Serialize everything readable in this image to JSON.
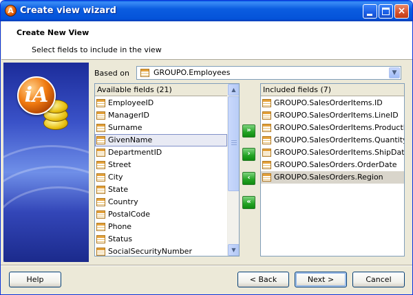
{
  "window": {
    "title": "Create view wizard",
    "app_icon_letter": "A"
  },
  "header": {
    "title": "Create New View",
    "subtitle": "Select fields to include in the view"
  },
  "sidebar_image": {
    "logo_text": "iA"
  },
  "based_on": {
    "label": "Based on",
    "value": "GROUPO.Employees",
    "icon": "table-icon"
  },
  "available": {
    "header": "Available fields (21)",
    "items": [
      {
        "label": "EmployeeID"
      },
      {
        "label": "ManagerID"
      },
      {
        "label": "Surname"
      },
      {
        "label": "GivenName",
        "selected": true
      },
      {
        "label": "DepartmentID"
      },
      {
        "label": "Street"
      },
      {
        "label": "City"
      },
      {
        "label": "State"
      },
      {
        "label": "Country"
      },
      {
        "label": "PostalCode"
      },
      {
        "label": "Phone"
      },
      {
        "label": "Status"
      },
      {
        "label": "SocialSecurityNumber"
      }
    ]
  },
  "included": {
    "header": "Included fields (7)",
    "items": [
      {
        "label": "GROUPO.SalesOrderItems.ID"
      },
      {
        "label": "GROUPO.SalesOrderItems.LineID"
      },
      {
        "label": "GROUPO.SalesOrderItems.ProductID"
      },
      {
        "label": "GROUPO.SalesOrderItems.Quantity"
      },
      {
        "label": "GROUPO.SalesOrderItems.ShipDate"
      },
      {
        "label": "GROUPO.SalesOrders.OrderDate"
      },
      {
        "label": "GROUPO.SalesOrders.Region",
        "selected": true
      }
    ]
  },
  "move_buttons": {
    "add_all": "»",
    "add": "›",
    "remove": "‹",
    "remove_all": "«"
  },
  "footer": {
    "help_label": "Help",
    "back_label": "< Back",
    "next_label": "Next >",
    "cancel_label": "Cancel"
  },
  "colors": {
    "title_bar": "#0453d9",
    "selection_border": "#7f8fc8",
    "move_button": "#23a323"
  }
}
